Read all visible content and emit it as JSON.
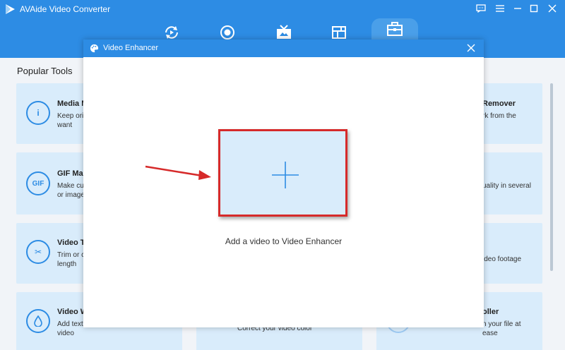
{
  "app": {
    "title": "AVAide Video Converter"
  },
  "toolbar": {
    "tabs": [
      {
        "icon": "convert-icon"
      },
      {
        "icon": "record-icon"
      },
      {
        "icon": "mv-icon"
      },
      {
        "icon": "collage-icon"
      },
      {
        "icon": "toolbox-icon",
        "active": true
      }
    ]
  },
  "main": {
    "section_title": "Popular Tools",
    "cards": [
      {
        "icon_text": "i",
        "title": "Media M",
        "desc_lines": [
          "Keep orig",
          "want"
        ]
      },
      {
        "icon_text": "GIF",
        "title": "GIF Mak",
        "desc_lines": [
          "Make cus",
          "or image"
        ]
      },
      {
        "icon_text": "✂",
        "title": "Video Tr",
        "desc_lines": [
          "Trim or c",
          "length"
        ]
      },
      {
        "icon_text": "💧",
        "title": "Video W",
        "desc_lines": [
          "Add text",
          "video"
        ]
      }
    ],
    "right_cards": [
      {
        "title": "Remover",
        "desc_lines": [
          "rk from the"
        ]
      },
      {
        "title": "",
        "desc_lines": [
          "uality in several"
        ]
      },
      {
        "title": "",
        "desc_lines": [
          "ideo footage"
        ]
      },
      {
        "title": "oller",
        "desc_lines": [
          "n your file at",
          "ease"
        ]
      }
    ],
    "middle_card_bottom": {
      "desc": "Correct your video color"
    }
  },
  "dialog": {
    "title": "Video Enhancer",
    "drop_label": "Add a video to Video Enhancer"
  },
  "colors": {
    "accent": "#2d8ce4",
    "card_bg": "#d9ecfb",
    "highlight": "#d62a2a"
  }
}
